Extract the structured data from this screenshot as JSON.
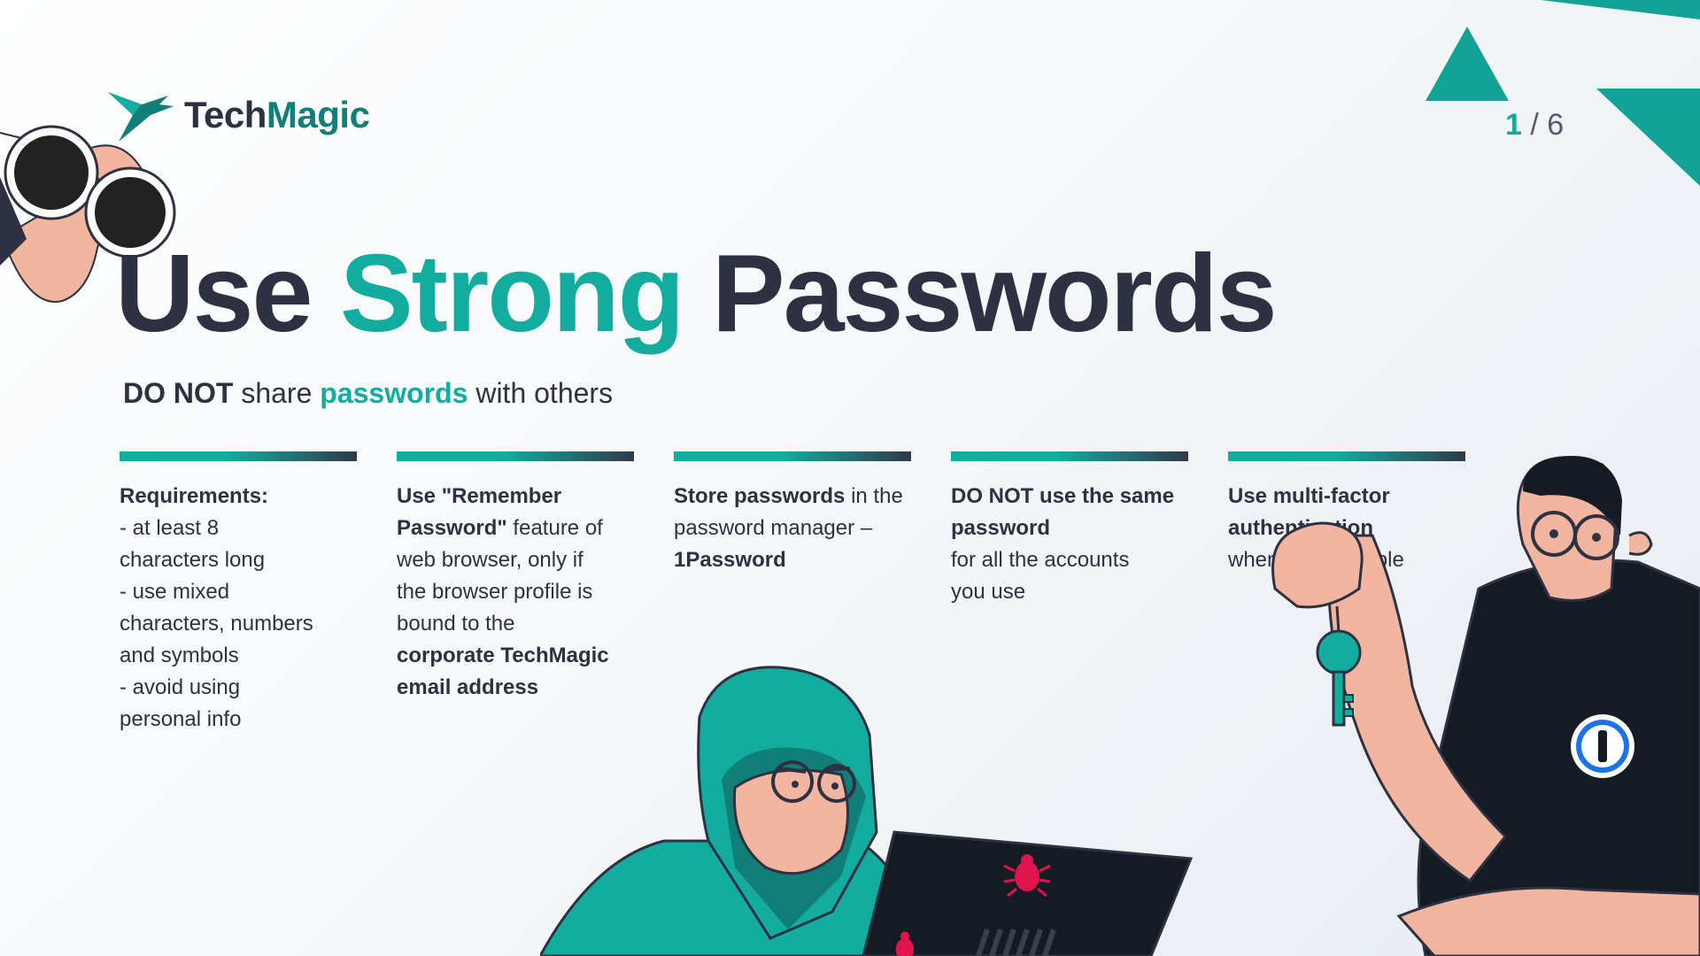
{
  "logo": {
    "word_tech": "Tech",
    "word_magic": "Magic",
    "icon": "bird-logo-icon"
  },
  "pager": {
    "current": "1",
    "separator": " / ",
    "total": "6"
  },
  "title": {
    "part1": "Use ",
    "accent": "Strong",
    "part2": " Passwords"
  },
  "subtitle": {
    "bold": "DO NOT",
    "mid": " share ",
    "accent": "passwords",
    "end": " with others"
  },
  "columns": [
    {
      "bold1": "Requirements:",
      "rest1": "\n - at least 8\ncharacters long\n - use mixed\ncharacters, numbers\nand symbols\n - avoid using\npersonal info"
    },
    {
      "bold1": "Use \"Remember\nPassword\"",
      "rest1": " feature of\nweb browser, only if\nthe browser profile is\nbound to the\n",
      "bold2": "corporate TechMagic\nemail address"
    },
    {
      "bold1": "Store passwords",
      "rest1": " in the\npassword manager –\n",
      "bold2": "1Password"
    },
    {
      "bold1": "DO NOT use the same\npassword",
      "rest1": "\nfor all the accounts\nyou use"
    },
    {
      "bold1": "Use multi-factor\nauthentication",
      "rest1": "\nwhenever possible"
    }
  ],
  "colors": {
    "accent": "#13ada0",
    "dark": "#2d3142",
    "bug": "#e0144c",
    "skin": "#f2b6a0"
  },
  "illustrations": [
    "binoculars-hand-icon",
    "hacker-with-laptop-icon",
    "man-holding-key-icon",
    "1password-badge-icon",
    "bug-icon"
  ]
}
